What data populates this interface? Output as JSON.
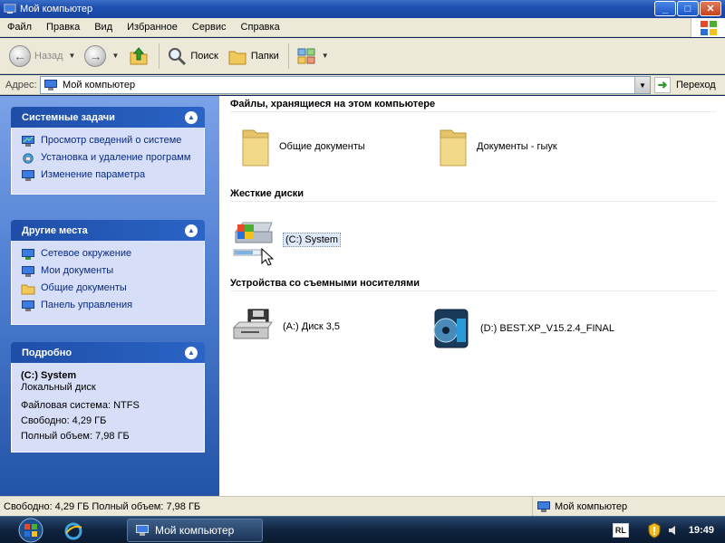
{
  "window": {
    "title": "Мой компьютер"
  },
  "menu": {
    "items": [
      "Файл",
      "Правка",
      "Вид",
      "Избранное",
      "Сервис",
      "Справка"
    ]
  },
  "toolbar": {
    "back_label": "Назад",
    "search_label": "Поиск",
    "folders_label": "Папки"
  },
  "address": {
    "label": "Адрес:",
    "value": "Мой компьютер",
    "go_label": "Переход"
  },
  "tasks_panel": {
    "title": "Системные задачи",
    "items": [
      "Просмотр сведений о системе",
      "Установка и удаление программ",
      "Изменение параметра"
    ]
  },
  "places_panel": {
    "title": "Другие места",
    "items": [
      "Сетевое окружение",
      "Мои документы",
      "Общие документы",
      "Панель управления"
    ]
  },
  "details_panel": {
    "title": "Подробно",
    "name": "(C:) System",
    "type": "Локальный диск",
    "fs": "Файловая система: NTFS",
    "free": "Свободно: 4,29 ГБ",
    "total": "Полный объем: 7,98 ГБ"
  },
  "main": {
    "group_files": "Файлы, хранящиеся на этом компьютере",
    "files": [
      "Общие документы",
      "Документы - гыук"
    ],
    "group_hdd": "Жесткие диски",
    "hdd": [
      "(C:) System"
    ],
    "group_removable": "Устройства со съемными носителями",
    "removable": [
      "(A:) Диск 3,5",
      "(D:) BEST.XP_V15.2.4_FINAL"
    ]
  },
  "status": {
    "left": "Свободно: 4,29 ГБ Полный объем: 7,98 ГБ",
    "right": "Мой компьютер"
  },
  "taskbar": {
    "window_label": "Мой компьютер",
    "lang": "RL",
    "clock": "19:49"
  }
}
